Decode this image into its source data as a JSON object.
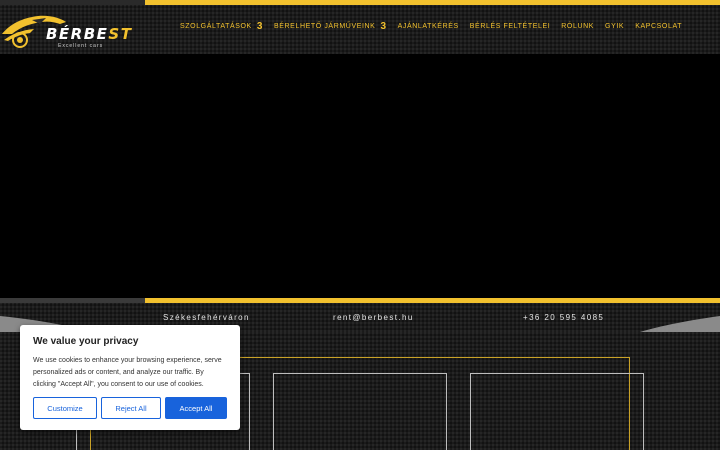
{
  "brand": {
    "name_prefix": "BÉRBE",
    "name_suffix": "ST",
    "tagline": "Excellent cars"
  },
  "nav": {
    "items": [
      {
        "label": "SZOLGÁLTATÁSOK",
        "has_dropdown": true,
        "chevron": "3"
      },
      {
        "label": "BÉRELHETŐ JÁRMŰVEINK",
        "has_dropdown": true,
        "chevron": "3"
      },
      {
        "label": "AJÁNLATKÉRÉS",
        "has_dropdown": false
      },
      {
        "label": "BÉRLÉS FELTÉTELEI",
        "has_dropdown": false
      },
      {
        "label": "RÓLUNK",
        "has_dropdown": false
      },
      {
        "label": "GYIK",
        "has_dropdown": false
      },
      {
        "label": "KAPCSOLAT",
        "has_dropdown": false
      }
    ]
  },
  "info": {
    "location": "Székesfehérváron",
    "email": "rent@berbest.hu",
    "phone": "+36 20 595 4085"
  },
  "cookie": {
    "title": "We value your privacy",
    "body": "We use cookies to enhance your browsing experience, serve personalized ads or content, and analyze our traffic. By clicking \"Accept All\", you consent to our use of cookies.",
    "customize_label": "Customize",
    "reject_label": "Reject All",
    "accept_label": "Accept All"
  },
  "colors": {
    "accent": "#f2c12e",
    "hero": "#000000",
    "cookie_button": "#1863dc"
  }
}
